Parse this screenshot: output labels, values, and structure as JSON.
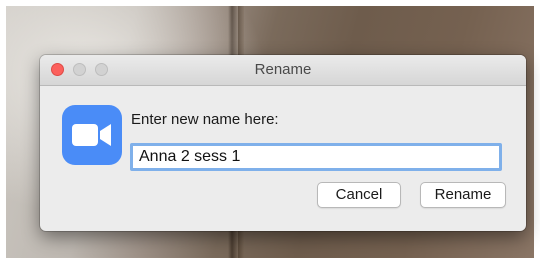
{
  "window": {
    "title": "Rename"
  },
  "prompt": {
    "label": "Enter new name here:"
  },
  "name_field": {
    "value": "Anna 2 sess 1"
  },
  "buttons": {
    "cancel_label": "Cancel",
    "rename_label": "Rename"
  },
  "icons": {
    "app": "zoom-video-camera-icon"
  },
  "colors": {
    "app_icon": "#4a8cf7",
    "close_button": "#fc605c",
    "focus_ring": "#7fb0ea"
  }
}
